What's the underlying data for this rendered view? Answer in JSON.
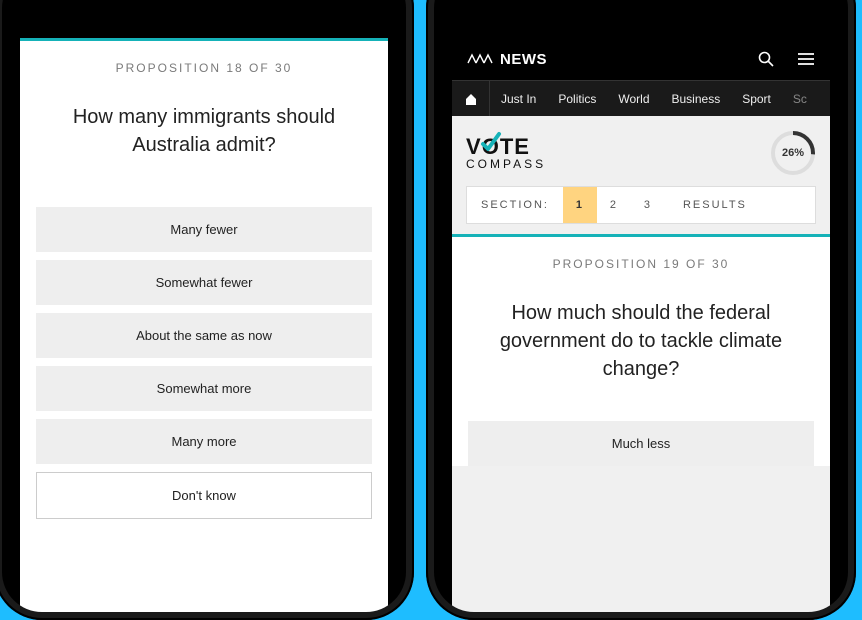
{
  "phone1": {
    "prop_label": "PROPOSITION 18 OF 30",
    "question": "How many immigrants should Australia admit?",
    "options": [
      "Many fewer",
      "Somewhat fewer",
      "About the same as now",
      "Somewhat more",
      "Many more"
    ],
    "dont_know": "Don't know"
  },
  "phone2": {
    "header": {
      "brand": "NEWS"
    },
    "nav": {
      "items": [
        "Just In",
        "Politics",
        "World",
        "Business",
        "Sport",
        "Sc"
      ]
    },
    "logo": {
      "line1_a": "V",
      "line1_b": "TE",
      "line2": "COMPASS"
    },
    "progress_pct": "26%",
    "sections": {
      "label": "SECTION:",
      "nums": [
        "1",
        "2",
        "3"
      ],
      "results": "RESULTS"
    },
    "prop_label": "PROPOSITION 19 OF 30",
    "question": "How much should the federal government do to tackle climate change?",
    "options": [
      "Much less"
    ]
  }
}
